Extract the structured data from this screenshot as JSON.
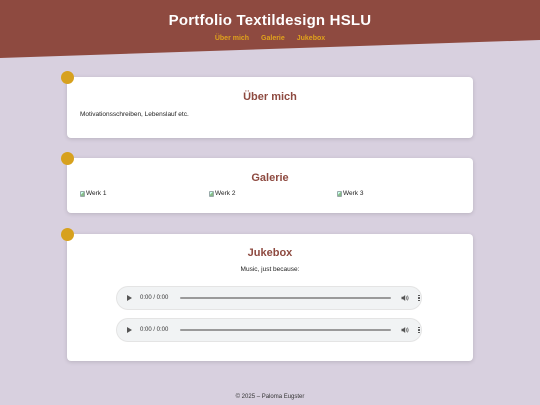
{
  "header": {
    "title": "Portfolio Textildesign HSLU",
    "nav": [
      "Über mich",
      "Galerie",
      "Jukebox"
    ],
    "bg_color": "#8e4a40",
    "nav_color": "#e0a21c"
  },
  "about": {
    "heading": "Über mich",
    "text": "Motivationsschreiben, Lebenslauf etc."
  },
  "gallery": {
    "heading": "Galerie",
    "images": [
      "Werk 1",
      "Werk 2",
      "Werk 3"
    ]
  },
  "jukebox": {
    "heading": "Jukebox",
    "lead": "Music, just because:",
    "players": [
      {
        "time": "0:00 / 0:00"
      },
      {
        "time": "0:00 / 0:00"
      }
    ]
  },
  "footer": {
    "text": "© 2025 – Paloma Eugster"
  },
  "colors": {
    "page_bg": "#d8d0df",
    "heading": "#8e4a40",
    "accent_dot": "#d7a11e"
  }
}
